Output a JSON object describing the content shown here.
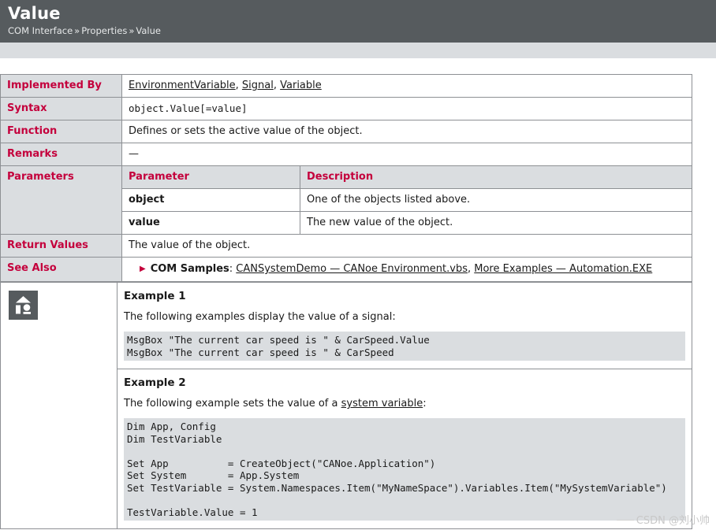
{
  "header": {
    "title": "Value",
    "breadcrumb": [
      {
        "label": "COM Interface"
      },
      {
        "label": "Properties"
      },
      {
        "label": "Value"
      }
    ],
    "separator": "»"
  },
  "spec": {
    "rows": {
      "implemented_by": {
        "label": "Implemented By",
        "links": [
          {
            "text": "EnvironmentVariable"
          },
          {
            "text": "Signal"
          },
          {
            "text": "Variable"
          }
        ],
        "separator": ", "
      },
      "syntax": {
        "label": "Syntax",
        "value": "object.Value[=value]"
      },
      "function": {
        "label": "Function",
        "value": "Defines or sets the active value of the object."
      },
      "remarks": {
        "label": "Remarks",
        "value": "—"
      },
      "parameters": {
        "label": "Parameters",
        "columns": [
          "Parameter",
          "Description"
        ],
        "rows": [
          {
            "name": "object",
            "description": "One of the objects listed above."
          },
          {
            "name": "value",
            "description": "The new value of the object."
          }
        ]
      },
      "return_values": {
        "label": "Return Values",
        "value": "The value of the object."
      },
      "see_also": {
        "label": "See Also",
        "bullet_icon": "triangle-right-icon",
        "entry_label": "COM Samples",
        "entry_colon": ":",
        "links": [
          {
            "text": "CANSystemDemo — CANoe Environment.vbs"
          },
          {
            "text": "More Examples — Automation.EXE"
          }
        ],
        "separator": ", "
      }
    }
  },
  "examples": {
    "icon_name": "home-building-icon",
    "items": [
      {
        "title": "Example 1",
        "text": "The following examples display the value of a signal:",
        "code": "MsgBox \"The current car speed is \" & CarSpeed.Value\nMsgBox \"The current car speed is \" & CarSpeed"
      },
      {
        "title": "Example 2",
        "text_before": "The following example sets the value of a ",
        "text_link": "system variable",
        "text_after": ":",
        "code_lines": [
          "Dim App, Config",
          "Dim TestVariable",
          "",
          "Set App          = CreateObject(\"CANoe.Application\")",
          "Set System       = App.System",
          "Set TestVariable = System.Namespaces.Item(\"MyNameSpace\").Variables.Item(\"MySystemVariable\")",
          "",
          "TestVariable.Value = 1"
        ]
      }
    ]
  },
  "watermark": {
    "text": "CSDN @刘小帅"
  },
  "colors": {
    "header_bg": "#565b5e",
    "subbar_bg": "#dadde0",
    "label_red": "#c4003c",
    "cell_grey": "#dadde0",
    "border": "#8d9094"
  }
}
